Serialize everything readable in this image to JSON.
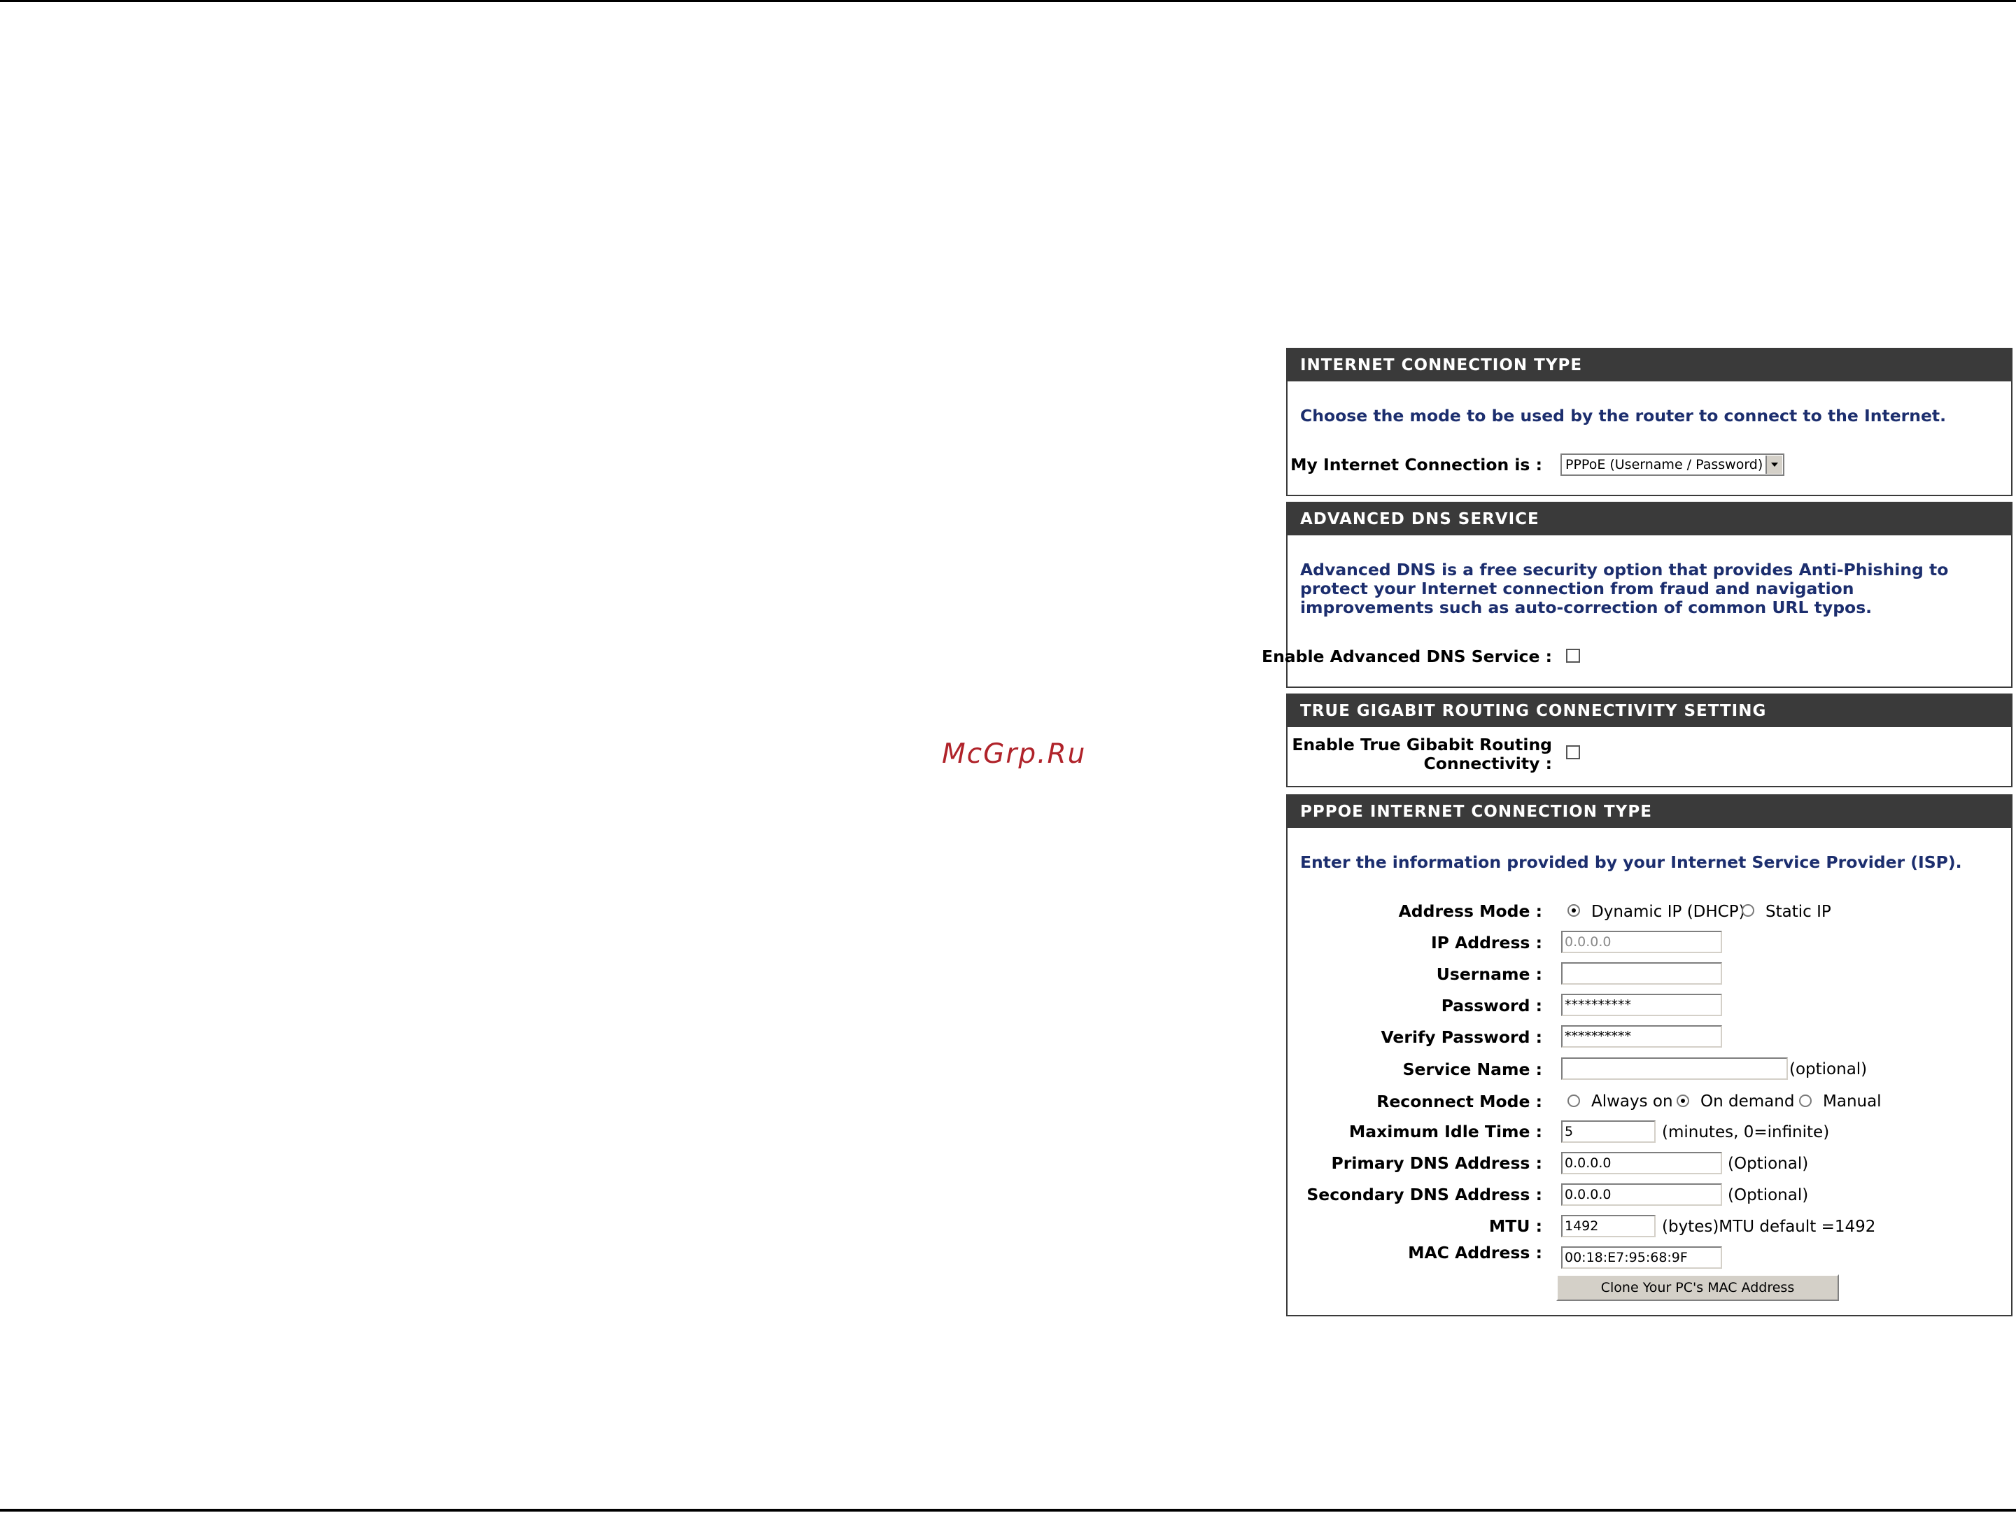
{
  "watermark": "McGrp.Ru",
  "internet_connection_type": {
    "header": "INTERNET CONNECTION TYPE",
    "description": "Choose the mode to be used by the router to connect to the Internet.",
    "connection_label": "My Internet Connection is :",
    "connection_value": "PPPoE (Username / Password)"
  },
  "advanced_dns": {
    "header": "ADVANCED DNS SERVICE",
    "description": "Advanced DNS is a free security option that provides Anti-Phishing to protect your Internet connection from fraud and navigation improvements such as auto-correction of common URL typos.",
    "enable_label": "Enable Advanced DNS Service :",
    "enabled": false
  },
  "true_gigabit": {
    "header": "TRUE GIGABIT ROUTING CONNECTIVITY SETTING",
    "enable_label_line1": "Enable True Gibabit Routing",
    "enable_label_line2": "Connectivity :",
    "enabled": false
  },
  "pppoe": {
    "header": "PPPOE INTERNET CONNECTION TYPE",
    "description": "Enter the information provided by your Internet Service Provider (ISP).",
    "address_mode": {
      "label": "Address Mode :",
      "options": [
        "Dynamic IP (DHCP)",
        "Static IP"
      ],
      "selected": "Dynamic IP (DHCP)"
    },
    "ip_address": {
      "label": "IP Address :",
      "value": "0.0.0.0"
    },
    "username": {
      "label": "Username :",
      "value": ""
    },
    "password": {
      "label": "Password :",
      "value": "**********"
    },
    "verify_password": {
      "label": "Verify Password :",
      "value": "**********"
    },
    "service_name": {
      "label": "Service Name :",
      "value": "",
      "note": "(optional)"
    },
    "reconnect_mode": {
      "label": "Reconnect Mode :",
      "options": [
        "Always on",
        "On demand",
        "Manual"
      ],
      "selected": "On demand"
    },
    "max_idle_time": {
      "label": "Maximum Idle Time :",
      "value": "5",
      "note": "(minutes, 0=infinite)"
    },
    "primary_dns": {
      "label": "Primary DNS Address :",
      "value": "0.0.0.0",
      "note": "(Optional)"
    },
    "secondary_dns": {
      "label": "Secondary DNS Address :",
      "value": "0.0.0.0",
      "note": "(Optional)"
    },
    "mtu": {
      "label": "MTU :",
      "value": "1492",
      "note": "(bytes)MTU default =1492"
    },
    "mac_address": {
      "label": "MAC Address :",
      "value": "00:18:E7:95:68:9F"
    },
    "clone_button": "Clone Your PC's MAC Address"
  }
}
